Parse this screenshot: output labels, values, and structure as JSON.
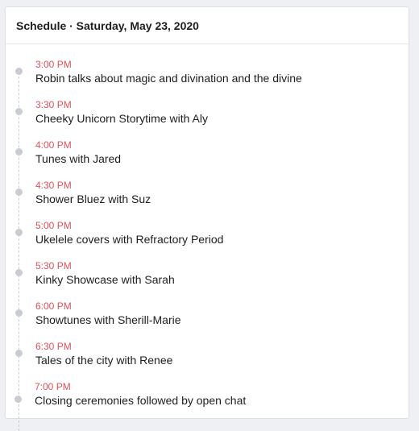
{
  "header": {
    "title": "Schedule · Saturday, May 23, 2020"
  },
  "colors": {
    "time_accent": "#e0515a",
    "dot": "#c9ccd1"
  },
  "events": [
    {
      "time": "3:00 PM",
      "title": "Robin talks about magic and divination and the divine"
    },
    {
      "time": "3:30 PM",
      "title": "Cheeky Unicorn Storytime with Aly"
    },
    {
      "time": "4:00 PM",
      "title": "Tunes with Jared"
    },
    {
      "time": "4:30 PM",
      "title": "Shower Bluez with Suz"
    },
    {
      "time": "5:00 PM",
      "title": "Ukelele covers with Refractory Period"
    },
    {
      "time": "5:30 PM",
      "title": "Kinky Showcase with Sarah"
    },
    {
      "time": "6:00 PM",
      "title": "Showtunes with Sherill-Marie"
    },
    {
      "time": "6:30 PM",
      "title": "Tales of the city with Renee"
    },
    {
      "time": "7:00 PM",
      "title": "Closing ceremonies followed by open chat"
    }
  ]
}
